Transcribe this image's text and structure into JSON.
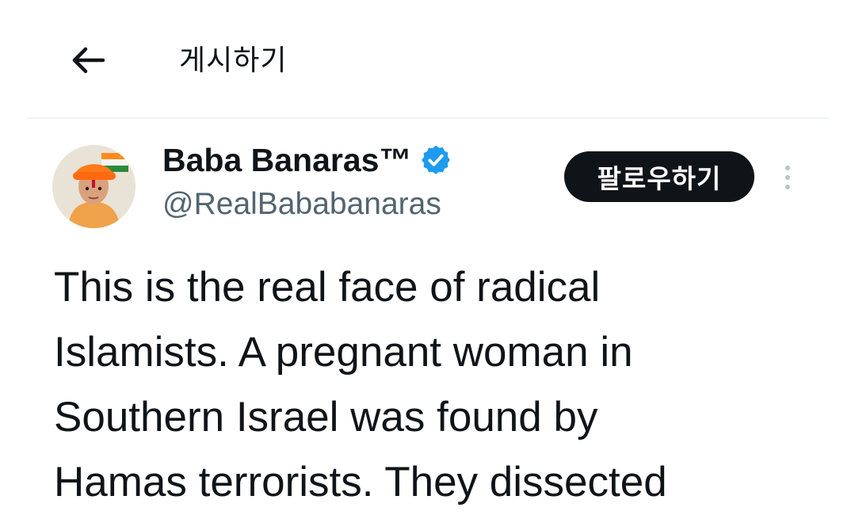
{
  "header": {
    "title": "게시하기",
    "back_icon": "arrow-left-icon"
  },
  "post": {
    "author": {
      "display_name": "Baba Banaras™",
      "handle": "@RealBababanaras",
      "verified": true,
      "verified_color": "#1d9bf0"
    },
    "follow_label": "팔로우하기",
    "more_icon": "more-vertical-icon",
    "text": "This is the real face of radical\nIslamists. A pregnant woman in\nSouthern Israel was found by\nHamas terrorists. They dissected"
  },
  "colors": {
    "text_primary": "#0f1419",
    "text_secondary": "#536471",
    "divider": "#eff3f4",
    "follow_bg": "#0f1419"
  }
}
